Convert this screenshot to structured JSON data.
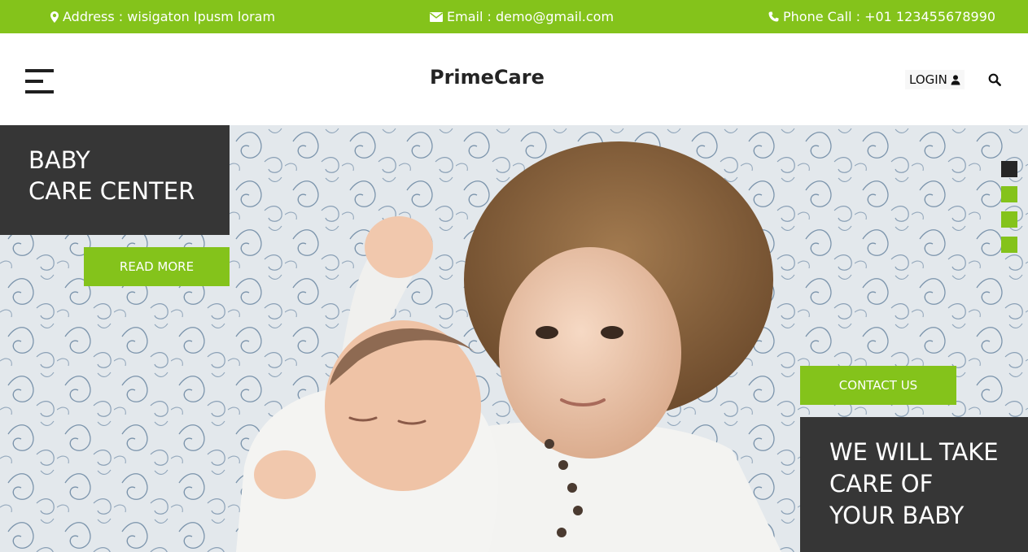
{
  "topbar": {
    "address": "Address : wisigaton Ipusm loram",
    "email": "Email : demo@gmail.com",
    "phone": "Phone Call : +01 123455678990"
  },
  "header": {
    "brand": "PrimeCare",
    "login_label": "LOGIN",
    "icons": [
      "menu-icon",
      "user-icon",
      "search-icon"
    ]
  },
  "hero": {
    "left_caption": [
      "BABY",
      "CARE CENTER"
    ],
    "read_more": "READ MORE",
    "contact_us": "CONTACT US",
    "right_caption": [
      "WE WILL TAKE",
      "CARE OF",
      "YOUR BABY"
    ],
    "slider_count": 4,
    "active_slide": 1
  },
  "colors": {
    "accent": "#84c31b",
    "dark_panel": "#363636",
    "brand_text": "#242424"
  }
}
